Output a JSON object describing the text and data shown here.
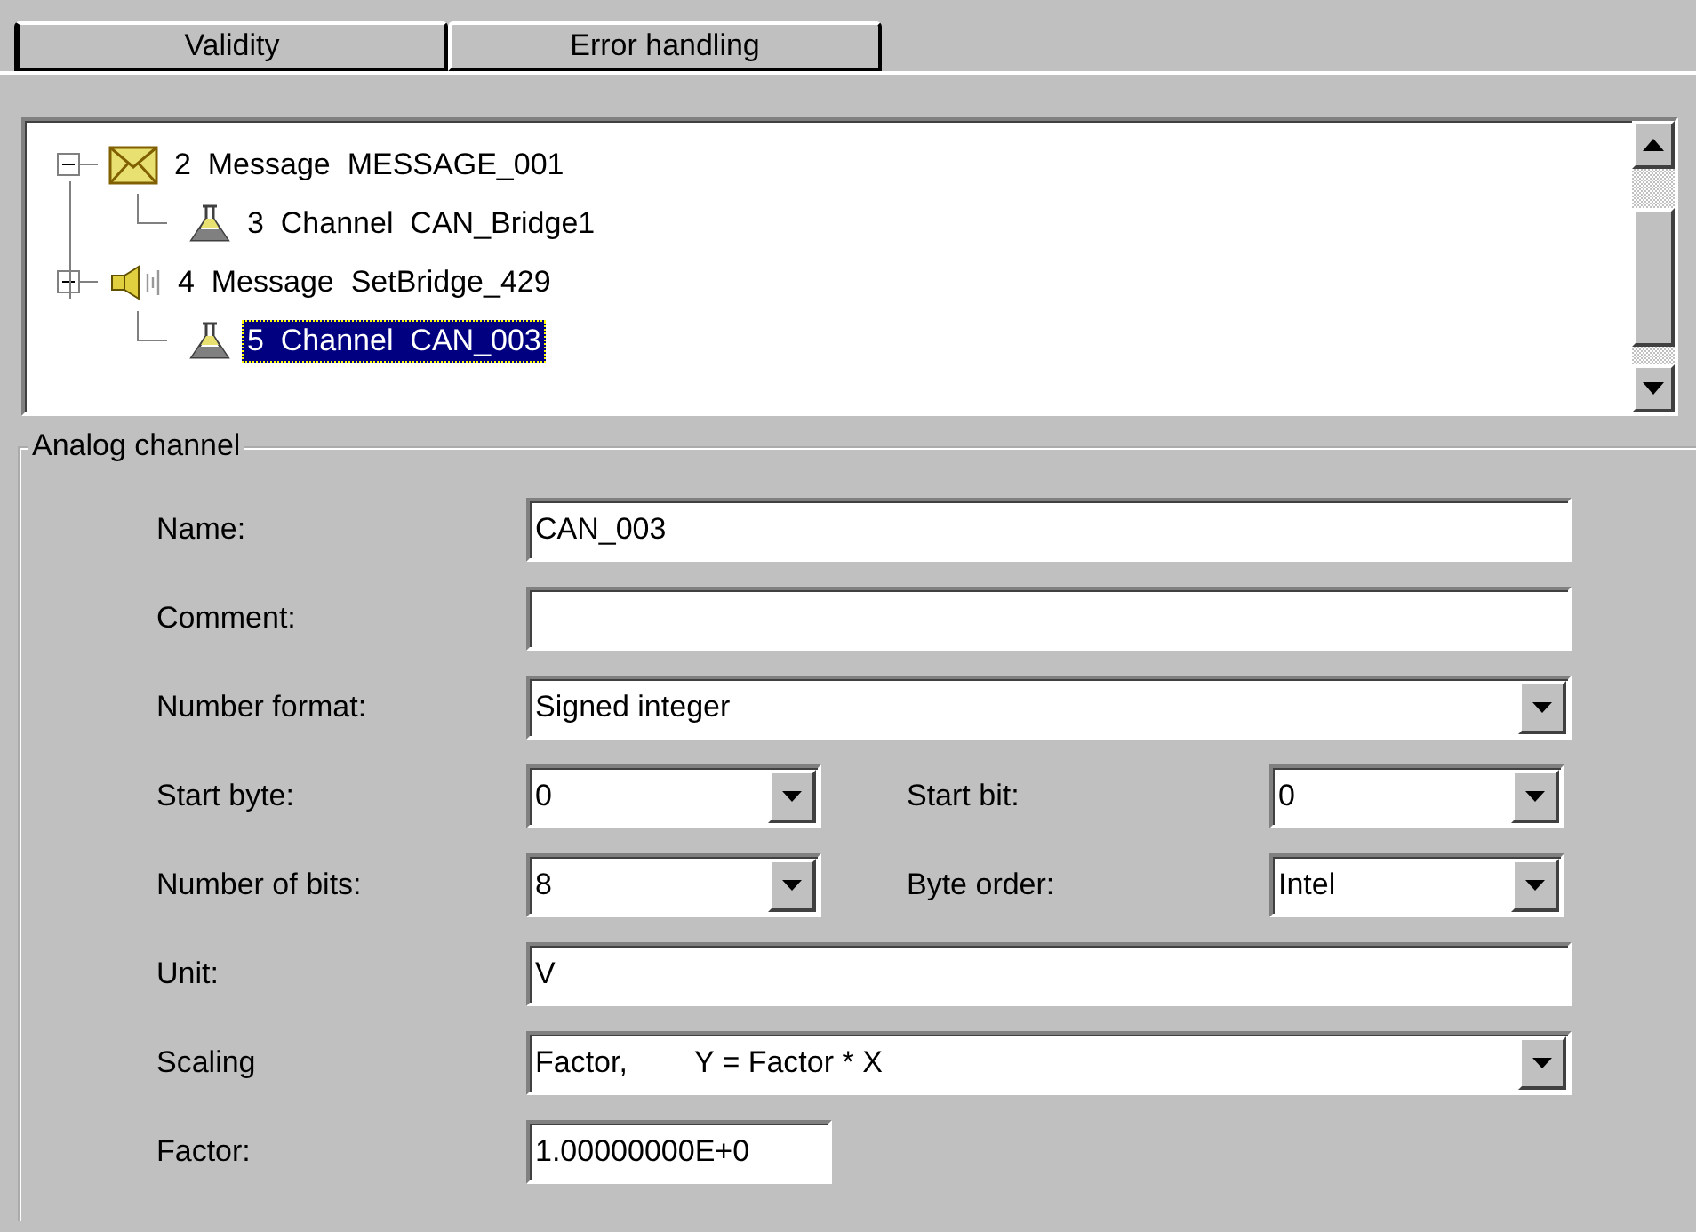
{
  "tabs": [
    {
      "label": "Validity",
      "selected": false
    },
    {
      "label": "Error handling",
      "selected": false
    }
  ],
  "tree": [
    {
      "label": "2  Message  MESSAGE_001",
      "kind": "mail",
      "expanded": true,
      "selected": false,
      "children": [
        {
          "label": "3  Channel  CAN_Bridge1",
          "kind": "channel",
          "selected": false
        }
      ]
    },
    {
      "label": "4  Message  SetBridge_429",
      "kind": "signal",
      "expanded": true,
      "selected": false,
      "children": [
        {
          "label": "5  Channel  CAN_003",
          "kind": "channel",
          "selected": true
        }
      ]
    }
  ],
  "group": {
    "title": "Analog channel",
    "rows": [
      [
        {
          "label": "Name:",
          "kind": "text",
          "value": "CAN_003"
        }
      ],
      [
        {
          "label": "Comment:",
          "kind": "text"
        }
      ],
      [
        {
          "label": "Number format:",
          "kind": "combo",
          "value": "Signed integer"
        }
      ],
      [
        {
          "label": "Start byte:",
          "kind": "combo",
          "value": "0"
        },
        {
          "label": "Start bit:",
          "kind": "combo",
          "value": "0"
        }
      ],
      [
        {
          "label": "Number of bits:",
          "kind": "combo",
          "value": "8"
        },
        {
          "label": "Byte order:",
          "kind": "combo",
          "value": "Intel"
        }
      ],
      [
        {
          "label": "Unit:",
          "kind": "text",
          "value": "V"
        }
      ],
      [
        {
          "label": "Scaling",
          "kind": "combo",
          "value": "Factor,        Y = Factor * X"
        }
      ],
      [
        {
          "label": "Factor:",
          "kind": "short",
          "value": "1.00000000E+0"
        }
      ]
    ]
  }
}
